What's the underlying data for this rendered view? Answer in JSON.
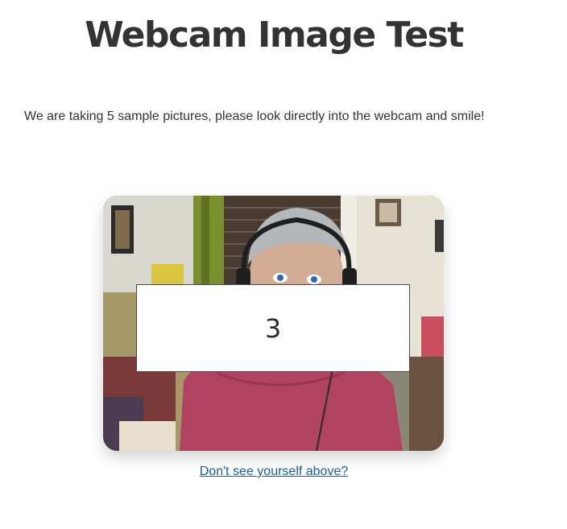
{
  "header": {
    "title": "Webcam Image Test"
  },
  "main": {
    "instructions": "We are taking 5 sample pictures, please look directly into the webcam and smile!",
    "countdown": "3",
    "help_link": "Don't see yourself above?"
  },
  "colors": {
    "title": "#333333",
    "link": "#1d5d8f",
    "shirt": "#b0435f"
  }
}
